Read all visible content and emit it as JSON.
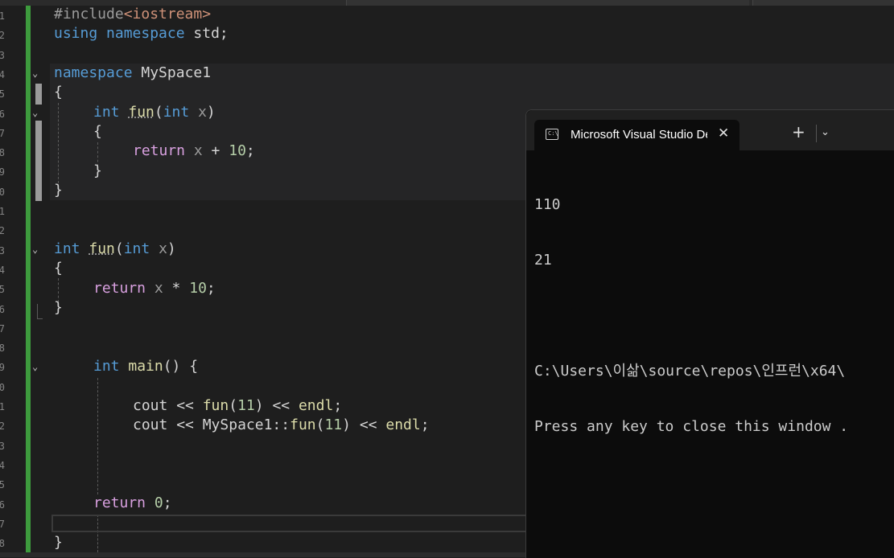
{
  "gutter": {
    "line_numbers": [
      "1",
      "2",
      "3",
      "4",
      "5",
      "6",
      "7",
      "8",
      "9",
      "0",
      "1",
      "2",
      "3",
      "4",
      "5",
      "6",
      "7",
      "8",
      "9",
      "0",
      "1",
      "2",
      "3",
      "4",
      "5",
      "6",
      "7",
      "8"
    ]
  },
  "code": {
    "l1_pre": "#include",
    "l1_inc": "<iostream>",
    "l2_kw1": "using",
    "l2_kw2": "namespace",
    "l2_rest": " std;",
    "l4_kw": "namespace",
    "l4_name": " MySpace1",
    "brace_open": "{",
    "brace_close": "}",
    "int_kw": "int",
    "fun_name": "fun",
    "paren_open": "(",
    "param_var": "x",
    "paren_close": ")",
    "return_kw": "return",
    "ret1_op": " + ",
    "ret1_num": "10",
    "semicolon": ";",
    "ret2_op": " * ",
    "ret2_num": "10",
    "main_name": "main",
    "main_rest": "() {",
    "cout": "cout",
    "shift": " << ",
    "num11": "11",
    "endl": "endl",
    "ns_prefix": "MySpace1",
    "scope_op": "::",
    "zero": "0"
  },
  "terminal": {
    "tab_icon_label": "C:\\",
    "tab_title": "Microsoft Visual Studio Debug",
    "close_glyph": "✕",
    "new_tab_glyph": "+",
    "dropdown_glyph": "⌄",
    "output_lines": [
      "110",
      "21",
      "",
      "C:\\Users\\이삶\\source\\repos\\인프런\\x64\\",
      "Press any key to close this window ."
    ]
  },
  "colors": {
    "editor_bg": "#1e1e1e",
    "keyword": "#569cd6",
    "function": "#dcdcaa",
    "number": "#b5cea8",
    "control": "#d8a0df",
    "changed_bar": "#3d9b3d",
    "terminal_bg": "#0c0c0c"
  }
}
